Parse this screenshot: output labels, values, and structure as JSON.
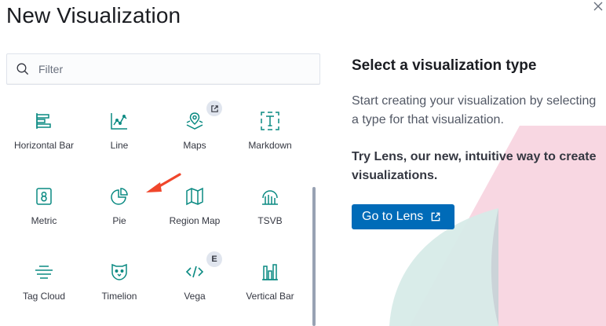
{
  "modal": {
    "title": "New Visualization",
    "close_icon": "close-icon"
  },
  "filter": {
    "placeholder": "Filter",
    "value": "",
    "icon": "search-icon"
  },
  "types": [
    {
      "label": "Horizontal Bar",
      "icon": "horizontal-bar-icon"
    },
    {
      "label": "Line",
      "icon": "line-chart-icon"
    },
    {
      "label": "Maps",
      "icon": "maps-icon",
      "badge": "external-link-icon"
    },
    {
      "label": "Markdown",
      "icon": "markdown-icon"
    },
    {
      "label": "Metric",
      "icon": "metric-icon"
    },
    {
      "label": "Pie",
      "icon": "pie-chart-icon"
    },
    {
      "label": "Region Map",
      "icon": "region-map-icon"
    },
    {
      "label": "TSVB",
      "icon": "tsvb-icon"
    },
    {
      "label": "Tag Cloud",
      "icon": "tag-cloud-icon"
    },
    {
      "label": "Timelion",
      "icon": "timelion-icon"
    },
    {
      "label": "Vega",
      "icon": "vega-icon",
      "badge_text": "E"
    },
    {
      "label": "Vertical Bar",
      "icon": "vertical-bar-icon"
    }
  ],
  "panel": {
    "title": "Select a visualization type",
    "description": "Start creating your visualization by selecting a type for that visualization.",
    "lens_promo": "Try Lens, our new, intuitive way to create visualizations.",
    "lens_button": "Go to Lens"
  },
  "colors": {
    "accent": "#006bb8",
    "icon": "#0a8a82",
    "annotation_arrow": "#f0462b"
  }
}
